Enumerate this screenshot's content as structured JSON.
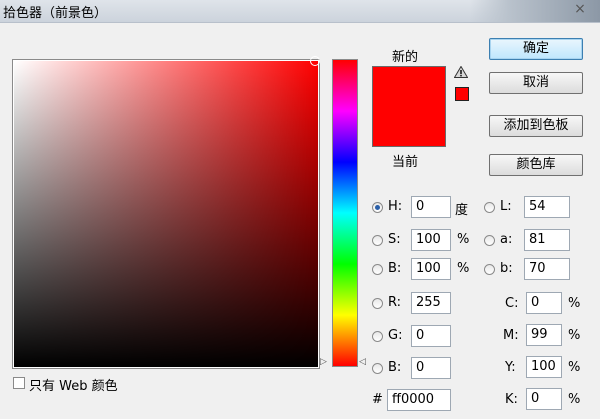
{
  "window": {
    "title": "拾色器（前景色）",
    "close_glyph": "×"
  },
  "color_field": {
    "hue_deg": 0,
    "marker_saturation": 100,
    "marker_brightness": 100
  },
  "preview": {
    "new_label": "新的",
    "current_label": "当前",
    "new_color": "#ff0000",
    "current_color": "#ff0000",
    "gamut_warning_icon": "warning-triangle-icon"
  },
  "buttons": {
    "ok": "确定",
    "cancel": "取消",
    "add_to_swatches": "添加到色板",
    "color_libraries": "颜色库"
  },
  "hsb": {
    "h": {
      "label": "H:",
      "value": "0",
      "unit": "度",
      "checked": true
    },
    "s": {
      "label": "S:",
      "value": "100",
      "unit": "%"
    },
    "b": {
      "label": "B:",
      "value": "100",
      "unit": "%"
    }
  },
  "lab": {
    "l": {
      "label": "L:",
      "value": "54"
    },
    "a": {
      "label": "a:",
      "value": "81"
    },
    "b": {
      "label": "b:",
      "value": "70"
    }
  },
  "rgb": {
    "r": {
      "label": "R:",
      "value": "255"
    },
    "g": {
      "label": "G:",
      "value": "0"
    },
    "b": {
      "label": "B:",
      "value": "0"
    }
  },
  "cmyk": {
    "c": {
      "label": "C:",
      "value": "0",
      "unit": "%"
    },
    "m": {
      "label": "M:",
      "value": "99",
      "unit": "%"
    },
    "y": {
      "label": "Y:",
      "value": "100",
      "unit": "%"
    },
    "k": {
      "label": "K:",
      "value": "0",
      "unit": "%"
    }
  },
  "hex": {
    "label": "#",
    "value": "ff0000"
  },
  "web_only": {
    "label": "只有 Web 颜色",
    "checked": false
  }
}
